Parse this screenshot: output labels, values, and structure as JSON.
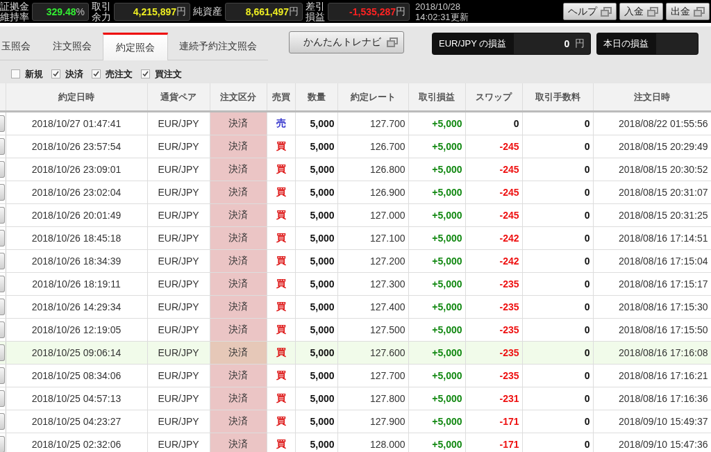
{
  "top_bar": {
    "stats": [
      {
        "label_lines": [
          "証拠金",
          "維持率"
        ],
        "value": "329.48",
        "unit": "%",
        "color": "#33ee33"
      },
      {
        "label_lines": [
          "取引",
          "余力"
        ],
        "value": "4,215,897",
        "unit": "円",
        "color": "#eeee22"
      },
      {
        "label_lines": [
          "純資産"
        ],
        "value": "8,661,497",
        "unit": "円",
        "color": "#eeee22"
      },
      {
        "label_lines": [
          "差引",
          "損益"
        ],
        "value": "-1,535,287",
        "unit": "円",
        "color": "#ff2222"
      }
    ],
    "updated_date": "2018/10/28",
    "updated_time": "14:02:31更新",
    "buttons": [
      {
        "label": "ヘルプ"
      },
      {
        "label": "入金"
      },
      {
        "label": "出金"
      }
    ]
  },
  "tabs": [
    {
      "label": "玉照会",
      "selected": false
    },
    {
      "label": "注文照会",
      "selected": false
    },
    {
      "label": "約定照会",
      "selected": true
    },
    {
      "label": "連続予約注文照会",
      "selected": false
    }
  ],
  "navi_button": "かんたんトレナビ",
  "pl_panels": [
    {
      "label": "EUR/JPY の損益",
      "value": "0",
      "unit": "円"
    },
    {
      "label": "本日の損益"
    }
  ],
  "filters": [
    {
      "label": "新規",
      "checked": false
    },
    {
      "label": "決済",
      "checked": true
    },
    {
      "label": "売注文",
      "checked": true
    },
    {
      "label": "買注文",
      "checked": true
    }
  ],
  "table": {
    "columns": [
      "約定日時",
      "通貨ペア",
      "注文区分",
      "売買",
      "数量",
      "約定レート",
      "取引損益",
      "スワップ",
      "取引手数料",
      "注文日時"
    ],
    "rows": [
      {
        "selected": false,
        "exec_time": "2018/10/27 01:47:41",
        "pair": "EUR/JPY",
        "order_type": "決済",
        "side": "売",
        "kind": "sell",
        "quantity": "5,000",
        "rate": "127.700",
        "profit": "+5,000",
        "swap": "0",
        "swap_negative": false,
        "fee": "0",
        "order_time": "2018/08/22 01:55:56"
      },
      {
        "selected": false,
        "exec_time": "2018/10/26 23:57:54",
        "pair": "EUR/JPY",
        "order_type": "決済",
        "side": "買",
        "kind": "buy",
        "quantity": "5,000",
        "rate": "126.700",
        "profit": "+5,000",
        "swap": "-245",
        "swap_negative": true,
        "fee": "0",
        "order_time": "2018/08/15 20:29:49"
      },
      {
        "selected": false,
        "exec_time": "2018/10/26 23:09:01",
        "pair": "EUR/JPY",
        "order_type": "決済",
        "side": "買",
        "kind": "buy",
        "quantity": "5,000",
        "rate": "126.800",
        "profit": "+5,000",
        "swap": "-245",
        "swap_negative": true,
        "fee": "0",
        "order_time": "2018/08/15 20:30:52"
      },
      {
        "selected": false,
        "exec_time": "2018/10/26 23:02:04",
        "pair": "EUR/JPY",
        "order_type": "決済",
        "side": "買",
        "kind": "buy",
        "quantity": "5,000",
        "rate": "126.900",
        "profit": "+5,000",
        "swap": "-245",
        "swap_negative": true,
        "fee": "0",
        "order_time": "2018/08/15 20:31:07"
      },
      {
        "selected": false,
        "exec_time": "2018/10/26 20:01:49",
        "pair": "EUR/JPY",
        "order_type": "決済",
        "side": "買",
        "kind": "buy",
        "quantity": "5,000",
        "rate": "127.000",
        "profit": "+5,000",
        "swap": "-245",
        "swap_negative": true,
        "fee": "0",
        "order_time": "2018/08/15 20:31:25"
      },
      {
        "selected": false,
        "exec_time": "2018/10/26 18:45:18",
        "pair": "EUR/JPY",
        "order_type": "決済",
        "side": "買",
        "kind": "buy",
        "quantity": "5,000",
        "rate": "127.100",
        "profit": "+5,000",
        "swap": "-242",
        "swap_negative": true,
        "fee": "0",
        "order_time": "2018/08/16 17:14:51"
      },
      {
        "selected": false,
        "exec_time": "2018/10/26 18:34:39",
        "pair": "EUR/JPY",
        "order_type": "決済",
        "side": "買",
        "kind": "buy",
        "quantity": "5,000",
        "rate": "127.200",
        "profit": "+5,000",
        "swap": "-242",
        "swap_negative": true,
        "fee": "0",
        "order_time": "2018/08/16 17:15:04"
      },
      {
        "selected": false,
        "exec_time": "2018/10/26 18:19:11",
        "pair": "EUR/JPY",
        "order_type": "決済",
        "side": "買",
        "kind": "buy",
        "quantity": "5,000",
        "rate": "127.300",
        "profit": "+5,000",
        "swap": "-235",
        "swap_negative": true,
        "fee": "0",
        "order_time": "2018/08/16 17:15:17"
      },
      {
        "selected": false,
        "exec_time": "2018/10/26 14:29:34",
        "pair": "EUR/JPY",
        "order_type": "決済",
        "side": "買",
        "kind": "buy",
        "quantity": "5,000",
        "rate": "127.400",
        "profit": "+5,000",
        "swap": "-235",
        "swap_negative": true,
        "fee": "0",
        "order_time": "2018/08/16 17:15:30"
      },
      {
        "selected": false,
        "exec_time": "2018/10/26 12:19:05",
        "pair": "EUR/JPY",
        "order_type": "決済",
        "side": "買",
        "kind": "buy",
        "quantity": "5,000",
        "rate": "127.500",
        "profit": "+5,000",
        "swap": "-235",
        "swap_negative": true,
        "fee": "0",
        "order_time": "2018/08/16 17:15:50"
      },
      {
        "selected": true,
        "exec_time": "2018/10/25 09:06:14",
        "pair": "EUR/JPY",
        "order_type": "決済",
        "side": "買",
        "kind": "buy",
        "quantity": "5,000",
        "rate": "127.600",
        "profit": "+5,000",
        "swap": "-235",
        "swap_negative": true,
        "fee": "0",
        "order_time": "2018/08/16 17:16:08"
      },
      {
        "selected": false,
        "exec_time": "2018/10/25 08:34:06",
        "pair": "EUR/JPY",
        "order_type": "決済",
        "side": "買",
        "kind": "buy",
        "quantity": "5,000",
        "rate": "127.700",
        "profit": "+5,000",
        "swap": "-235",
        "swap_negative": true,
        "fee": "0",
        "order_time": "2018/08/16 17:16:21"
      },
      {
        "selected": false,
        "exec_time": "2018/10/25 04:57:13",
        "pair": "EUR/JPY",
        "order_type": "決済",
        "side": "買",
        "kind": "buy",
        "quantity": "5,000",
        "rate": "127.800",
        "profit": "+5,000",
        "swap": "-231",
        "swap_negative": true,
        "fee": "0",
        "order_time": "2018/08/16 17:16:36"
      },
      {
        "selected": false,
        "exec_time": "2018/10/25 04:23:27",
        "pair": "EUR/JPY",
        "order_type": "決済",
        "side": "買",
        "kind": "buy",
        "quantity": "5,000",
        "rate": "127.900",
        "profit": "+5,000",
        "swap": "-171",
        "swap_negative": true,
        "fee": "0",
        "order_time": "2018/09/10 15:49:37"
      },
      {
        "selected": false,
        "exec_time": "2018/10/25 02:32:06",
        "pair": "EUR/JPY",
        "order_type": "決済",
        "side": "買",
        "kind": "buy",
        "quantity": "5,000",
        "rate": "128.000",
        "profit": "+5,000",
        "swap": "-171",
        "swap_negative": true,
        "fee": "0",
        "order_time": "2018/09/10 15:47:36"
      }
    ]
  }
}
